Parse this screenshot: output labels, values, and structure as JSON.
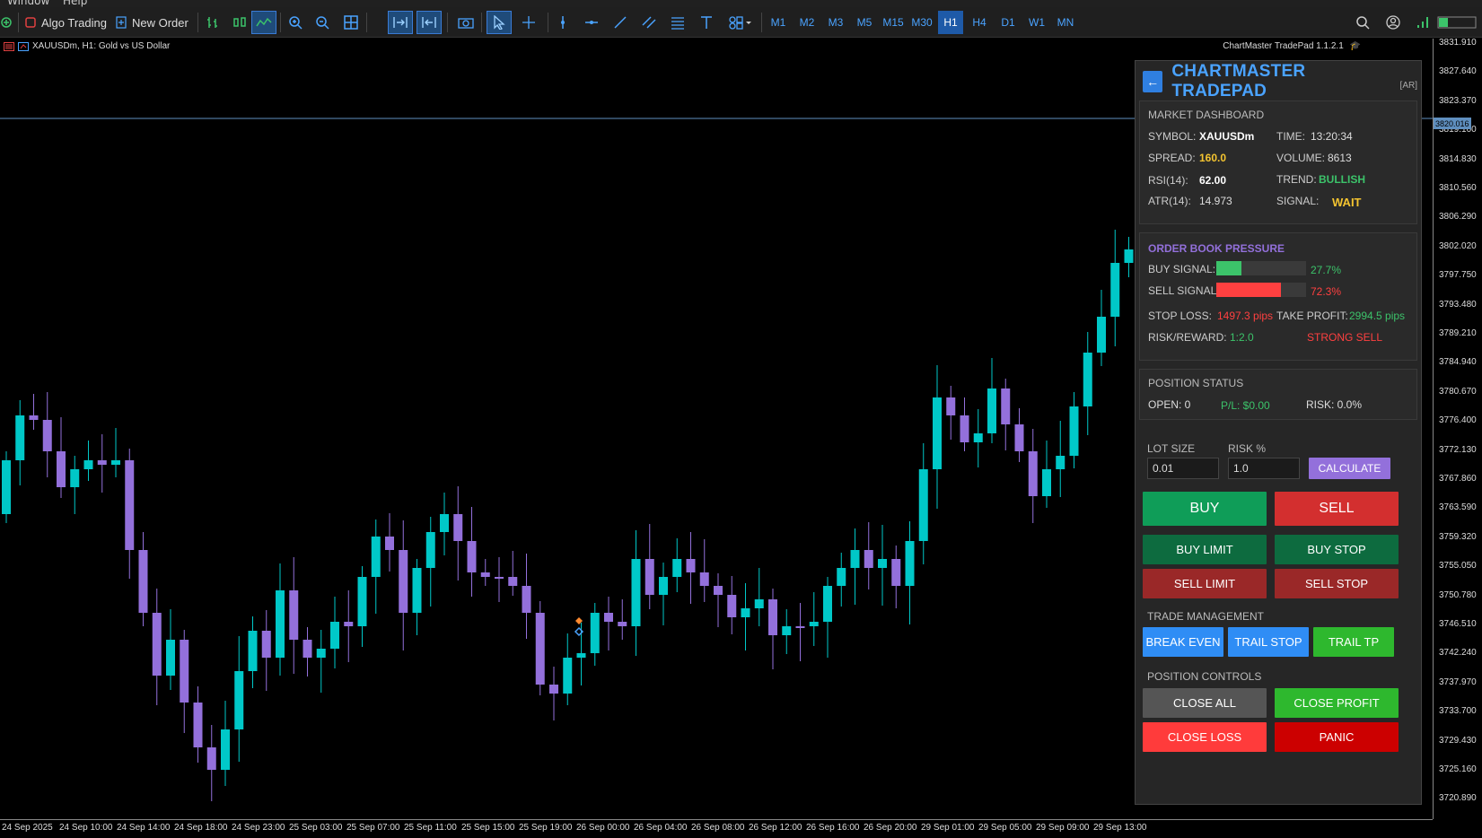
{
  "menu": {
    "window": "Window",
    "help": "Help"
  },
  "toolbar": {
    "algo_trading": "Algo Trading",
    "new_order": "New Order",
    "timeframes": [
      "M1",
      "M2",
      "M3",
      "M5",
      "M15",
      "M30",
      "H1",
      "H4",
      "D1",
      "W1",
      "MN"
    ],
    "active_timeframe": "H1"
  },
  "chart": {
    "symbol_info": "XAUUSDm, H1:  Gold vs US Dollar",
    "ea_label": "ChartMaster TradePad 1.1.2.1",
    "current_price": "3820.016",
    "price_ticks": [
      "3831.910",
      "3827.640",
      "3823.370",
      "3819.100",
      "3814.830",
      "3810.560",
      "3806.290",
      "3802.020",
      "3797.750",
      "3793.480",
      "3789.210",
      "3784.940",
      "3780.670",
      "3776.400",
      "3772.130",
      "3767.860",
      "3763.590",
      "3759.320",
      "3755.050",
      "3750.780",
      "3746.510",
      "3742.240",
      "3737.970",
      "3733.700",
      "3729.430",
      "3725.160",
      "3720.890"
    ],
    "time_ticks": [
      "24 Sep 2025",
      "24 Sep 10:00",
      "24 Sep 14:00",
      "24 Sep 18:00",
      "24 Sep 23:00",
      "25 Sep 03:00",
      "25 Sep 07:00",
      "25 Sep 11:00",
      "25 Sep 15:00",
      "25 Sep 19:00",
      "26 Sep 00:00",
      "26 Sep 04:00",
      "26 Sep 08:00",
      "26 Sep 12:00",
      "26 Sep 16:00",
      "26 Sep 20:00",
      "29 Sep 01:00",
      "29 Sep 05:00",
      "29 Sep 09:00",
      "29 Sep 13:00"
    ],
    "colors": {
      "bull": "#00c8c8",
      "bear": "#9370db",
      "price_line": "#5f8fbf"
    }
  },
  "panel": {
    "back_icon": "←",
    "title": "CHARTMASTER TRADEPAD",
    "lang": "[AR]",
    "dashboard": {
      "title": "MARKET DASHBOARD",
      "symbol_label": "SYMBOL:",
      "symbol": "XAUUSDm",
      "time_label": "TIME:",
      "time": "13:20:34",
      "spread_label": "SPREAD:",
      "spread": "160.0",
      "volume_label": "VOLUME:",
      "volume": "8613",
      "rsi_label": "RSI(14):",
      "rsi": "62.00",
      "trend_label": "TREND:",
      "trend": "BULLISH",
      "atr_label": "ATR(14):",
      "atr": "14.973",
      "signal_label": "SIGNAL:",
      "signal": "WAIT"
    },
    "orderbook": {
      "title": "ORDER BOOK PRESSURE",
      "buy_label": "BUY SIGNAL:",
      "buy_pct": "27.7%",
      "buy_fraction": 0.277,
      "sell_label": "SELL SIGNAL:",
      "sell_pct": "72.3%",
      "sell_fraction": 0.723,
      "sl_label": "STOP LOSS:",
      "sl": "1497.3 pips",
      "tp_label": "TAKE PROFIT:",
      "tp": "2994.5 pips",
      "rr_label": "RISK/REWARD:",
      "rr": "1:2.0",
      "verdict": "STRONG SELL"
    },
    "position": {
      "title": "POSITION STATUS",
      "open": "OPEN: 0",
      "pl": "P/L: $0.00",
      "risk": "RISK: 0.0%"
    },
    "order": {
      "lot_label": "LOT SIZE",
      "lot": "0.01",
      "risk_label": "RISK %",
      "risk": "1.0",
      "calculate": "CALCULATE",
      "buy": "BUY",
      "sell": "SELL",
      "buy_limit": "BUY LIMIT",
      "buy_stop": "BUY STOP",
      "sell_limit": "SELL LIMIT",
      "sell_stop": "SELL STOP"
    },
    "trade_mgmt": {
      "title": "TRADE MANAGEMENT",
      "break_even": "BREAK EVEN",
      "trail_stop": "TRAIL STOP",
      "trail_tp": "TRAIL TP"
    },
    "controls": {
      "title": "POSITION CONTROLS",
      "close_all": "CLOSE ALL",
      "close_profit": "CLOSE PROFIT",
      "close_loss": "CLOSE LOSS",
      "panic": "PANIC"
    }
  }
}
